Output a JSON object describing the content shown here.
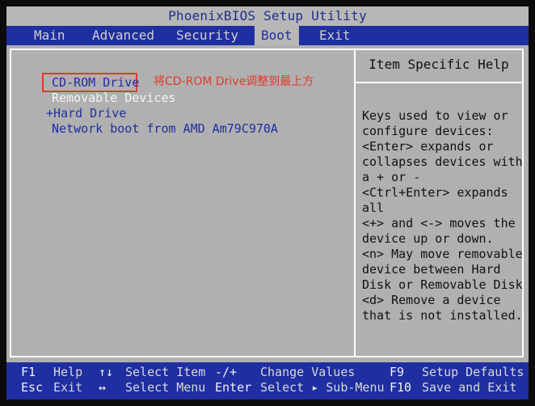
{
  "title": "PhoenixBIOS Setup Utility",
  "menu": {
    "items": [
      {
        "label": "Main"
      },
      {
        "label": "Advanced"
      },
      {
        "label": "Security"
      },
      {
        "label": "Boot",
        "active": true
      },
      {
        "label": "Exit"
      }
    ]
  },
  "boot": {
    "items": [
      {
        "label": "CD-ROM Drive",
        "selected": true
      },
      {
        "label": "Removable Devices"
      },
      {
        "label": "+Hard Drive"
      },
      {
        "label": "Network boot from AMD Am79C970A"
      }
    ],
    "annotation": "将CD-ROM Drive调整到最上方"
  },
  "help": {
    "title": "Item Specific Help",
    "text": "Keys used to view or\nconfigure devices:\n<Enter> expands or\ncollapses devices with\na + or -\n<Ctrl+Enter> expands\nall\n<+> and <-> moves the\ndevice up or down.\n<n> May move removable\ndevice between Hard\nDisk or Removable Disk\n<d> Remove a device\nthat is not installed."
  },
  "footer": {
    "row1": [
      {
        "key": "F1",
        "action": "Help"
      },
      {
        "key": "↑↓",
        "action": "Select Item"
      },
      {
        "key": "-/+",
        "action": "Change Values"
      },
      {
        "key": "F9",
        "action": "Setup Defaults"
      }
    ],
    "row2": [
      {
        "key": "Esc",
        "action": "Exit"
      },
      {
        "key": "↔",
        "action": "Select Menu"
      },
      {
        "key": "Enter",
        "action": "Select ▸ Sub-Menu"
      },
      {
        "key": "F10",
        "action": "Save and Exit"
      }
    ]
  },
  "colors": {
    "menu_bar": "#1f2ea0",
    "panel": "#b0b0b0",
    "annotation": "#e23a2a"
  }
}
